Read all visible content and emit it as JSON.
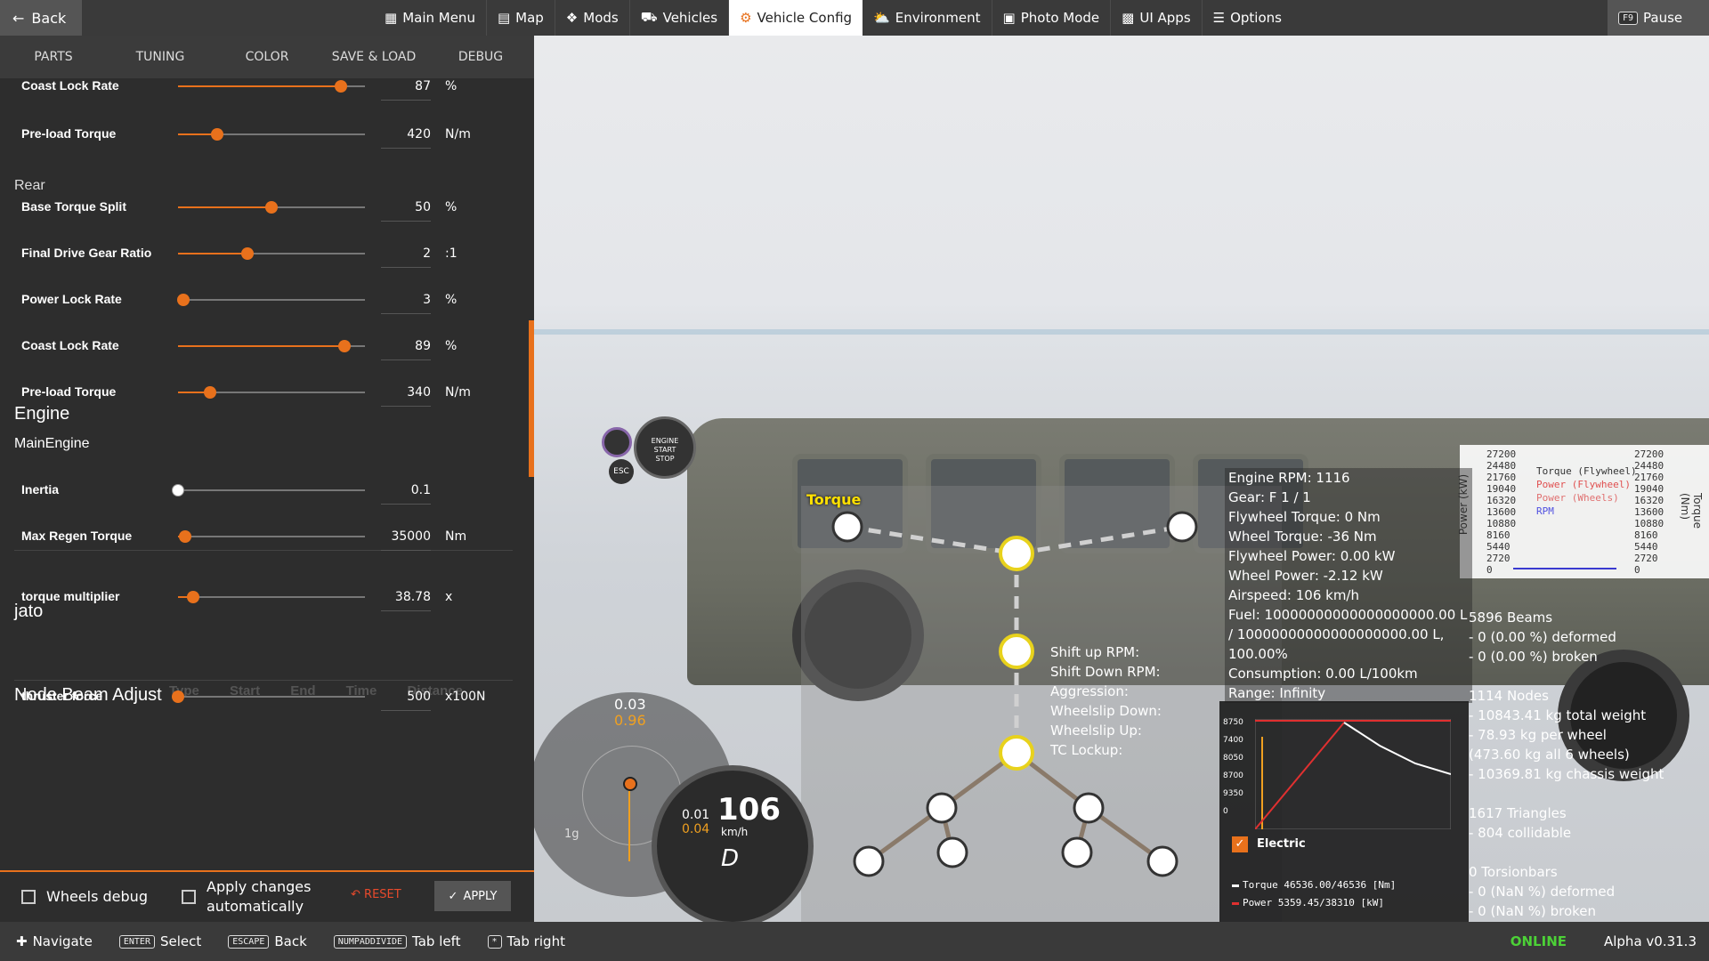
{
  "topbar": {
    "back_label": "Back",
    "menu": [
      {
        "label": "Main Menu",
        "icon": "main-menu-icon"
      },
      {
        "label": "Map",
        "icon": "map-icon"
      },
      {
        "label": "Mods",
        "icon": "puzzle-icon"
      },
      {
        "label": "Vehicles",
        "icon": "car-icon"
      },
      {
        "label": "Vehicle Config",
        "icon": "engine-icon",
        "active": true
      },
      {
        "label": "Environment",
        "icon": "weather-icon"
      },
      {
        "label": "Photo Mode",
        "icon": "camera-icon"
      },
      {
        "label": "UI Apps",
        "icon": "ui-apps-icon"
      },
      {
        "label": "Options",
        "icon": "sliders-icon"
      }
    ],
    "pause_key": "F9",
    "pause_label": "Pause"
  },
  "tabs": [
    "PARTS",
    "TUNING",
    "COLOR",
    "SAVE & LOAD",
    "DEBUG"
  ],
  "tuning": {
    "rows": [
      {
        "label": "Coast Lock Rate",
        "value": "87",
        "unit": "%",
        "level": 0.87
      },
      {
        "label": "Pre-load Torque",
        "value": "420",
        "unit": "N/m",
        "level": 0.21
      },
      {
        "label": "Base Torque Split",
        "value": "50",
        "unit": "%",
        "level": 0.5
      },
      {
        "label": "Final Drive Gear Ratio",
        "value": "2",
        "unit": ":1",
        "level": 0.37
      },
      {
        "label": "Power Lock Rate",
        "value": "3",
        "unit": "%",
        "level": 0.03
      },
      {
        "label": "Coast Lock Rate",
        "value": "89",
        "unit": "%",
        "level": 0.89
      },
      {
        "label": "Pre-load Torque",
        "value": "340",
        "unit": "N/m",
        "level": 0.17
      },
      {
        "label": "Inertia",
        "value": "0.1",
        "unit": "",
        "level": 0.0
      },
      {
        "label": "Max Regen Torque",
        "value": "35000",
        "unit": "Nm",
        "level": 0.04
      },
      {
        "label": "torque multiplier",
        "value": "38.78",
        "unit": "x",
        "level": 0.08
      },
      {
        "label": "thruster force",
        "value": "500",
        "unit": "x100N",
        "level": 0.0
      }
    ],
    "sections": {
      "rear": "Rear",
      "engine": "Engine",
      "main_engine": "MainEngine",
      "jato": "jato",
      "node_beam": "Node Beam Adjust"
    },
    "ghost_cols": [
      "Type",
      "Start",
      "End",
      "Time",
      "Distance"
    ]
  },
  "bottom": {
    "wheels_debug": "Wheels debug",
    "apply_auto_line1": "Apply changes",
    "apply_auto_line2": "automatically",
    "reset": "RESET",
    "apply": "APPLY"
  },
  "engine_info": [
    "Engine RPM: 1116",
    "Gear: F 1 / 1",
    "Flywheel Torque: 0 Nm",
    "Wheel Torque: -36 Nm",
    "Flywheel Power: 0.00 kW",
    "Wheel Power: -2.12 kW",
    "Airspeed: 106 km/h",
    "Fuel: 10000000000000000000.00 L",
    "/ 10000000000000000000.00 L,",
    "100.00%",
    "Consumption: 0.00 L/100km",
    "Range: Infinity"
  ],
  "shift_info": [
    "Shift up RPM:",
    "Shift Down RPM:",
    "Aggression:",
    "Wheelslip Down:",
    "Wheelslip Up:",
    "TC Lockup:"
  ],
  "beam_info": [
    "5896 Beams",
    " - 0 (0.00 %) deformed",
    " - 0 (0.00 %) broken",
    "",
    "1114 Nodes",
    " - 10843.41 kg total weight",
    " - 78.93 kg per wheel",
    " (473.60 kg all 6 wheels)",
    " - 10369.81 kg chassis weight",
    "",
    "1617 Triangles",
    " - 804 collidable",
    "",
    "0 Torsionbars",
    " - 0 (NaN %) deformed",
    " - 0 (NaN %) broken"
  ],
  "torque_graph": {
    "left_ticks": [
      "27200",
      "24480",
      "21760",
      "19040",
      "16320",
      "13600",
      "10880",
      "8160",
      "5440",
      "2720",
      "0"
    ],
    "legend": [
      "Torque (Flywheel)",
      "Power (Flywheel)",
      "Power (Wheels)",
      "RPM"
    ],
    "left_axis": "Power (kW)",
    "right_axis": "Torque (Nm)"
  },
  "power_graph": {
    "y_ticks": [
      "8750",
      "7400",
      "8050",
      "8700",
      "9350",
      "0"
    ],
    "electric_label": "Electric",
    "torque_line": "Torque 46536.00/46536 [Nm]",
    "power_line": "Power  5359.45/38310  [kW]"
  },
  "torque_tool_label": "Torque",
  "hud": {
    "gforce_top": "0.03",
    "gforce_bottom": "0.96",
    "gforce_1g": "1g",
    "speed": "106",
    "speed_unit": "km/h",
    "gear": "D",
    "small_readout": "0.01",
    "small_readout2": "0.04",
    "engine_btn": [
      "ENGINE",
      "START",
      "STOP"
    ],
    "esc": "ESC"
  },
  "statusbar": {
    "navigate": "Navigate",
    "enter_key": "ENTER",
    "select": "Select",
    "escape_key": "ESCAPE",
    "back": "Back",
    "numpad_key": "NUMPADDIVIDE",
    "tab_left": "Tab left",
    "star_key": "*",
    "tab_right": "Tab right",
    "online": "ONLINE",
    "version": "Alpha v0.31.3"
  },
  "colors": {
    "accent": "#e8711c",
    "online": "#4cd137"
  }
}
